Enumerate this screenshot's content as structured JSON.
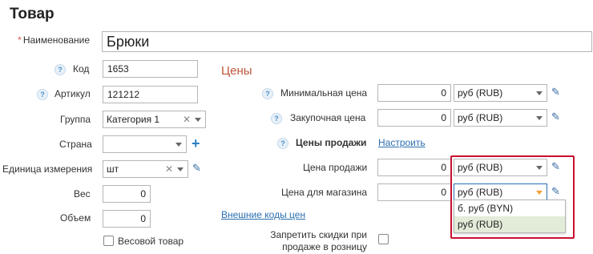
{
  "page": {
    "title": "Товар"
  },
  "fields": {
    "name": {
      "label": "Наименование",
      "required_mark": "*",
      "value": "Брюки"
    },
    "code": {
      "label": "Код",
      "value": "1653"
    },
    "article": {
      "label": "Артикул",
      "value": "121212"
    },
    "group": {
      "label": "Группа",
      "value": "Категория 1"
    },
    "country": {
      "label": "Страна",
      "value": ""
    },
    "unit": {
      "label": "Единица измерения",
      "value": "шт"
    },
    "weight": {
      "label": "Вес",
      "value": "0"
    },
    "volume": {
      "label": "Объем",
      "value": "0"
    },
    "weighted": {
      "label": "Весовой товар",
      "checked": false
    }
  },
  "prices": {
    "section_title": "Цены",
    "min_price": {
      "label": "Минимальная цена",
      "value": "0",
      "currency": "руб (RUB)"
    },
    "purchase_price": {
      "label": "Закупочная цена",
      "value": "0",
      "currency": "руб (RUB)"
    },
    "sale_prices": {
      "label": "Цены продажи",
      "configure_link": "Настроить"
    },
    "sale_price": {
      "label": "Цена продажи",
      "value": "0",
      "currency": "руб (RUB)"
    },
    "store_price": {
      "label": "Цена для магазина",
      "value": "0",
      "currency": "руб (RUB)"
    },
    "external_codes_link": "Внешние коды цен",
    "no_discounts": {
      "label_line1": "Запретить скидки при",
      "label_line2": "продаже в розницу",
      "checked": false
    }
  },
  "currency_dropdown": {
    "options": [
      "б. руб (BYN)",
      "руб (RUB)"
    ],
    "highlighted": "руб (RUB)"
  },
  "icons": {
    "help": "?",
    "clear": "✕",
    "add": "+",
    "edit": "✎"
  },
  "colors": {
    "section_title": "#c0543a",
    "link": "#2a6fb0",
    "highlight_box": "#c8102e",
    "option_highlight": "#e2ecd8"
  }
}
